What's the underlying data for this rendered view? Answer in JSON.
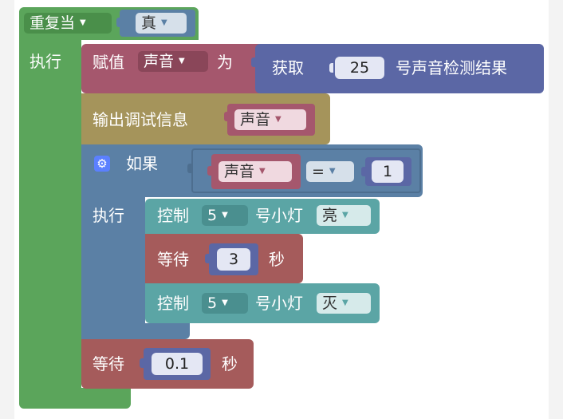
{
  "colors": {
    "loop_green": "#5ba55b",
    "assign_maroon": "#a5576d",
    "get_indigo": "#5b67a5",
    "debug_olive": "#a5945b",
    "if_blue": "#5b80a5",
    "control_teal": "#5ba5a5",
    "wait_red": "#a55b5b",
    "value_teal_dark": "#4a8f8f"
  },
  "loop": {
    "keyword": "重复当",
    "condition": "真",
    "do_label": "执行"
  },
  "assign": {
    "keyword": "赋值",
    "variable": "声音",
    "as_label": "为"
  },
  "get_sensor": {
    "keyword": "获取",
    "port": "25",
    "suffix": "号声音检测结果"
  },
  "debug": {
    "keyword": "输出调试信息",
    "variable": "声音"
  },
  "if_block": {
    "keyword": "如果",
    "do_label": "执行",
    "left": "声音",
    "operator": "=",
    "right": "1"
  },
  "control_on": {
    "keyword": "控制",
    "port": "5",
    "target": "号小灯",
    "state": "亮"
  },
  "wait_inner": {
    "keyword": "等待",
    "value": "3",
    "unit": "秒"
  },
  "control_off": {
    "keyword": "控制",
    "port": "5",
    "target": "号小灯",
    "state": "灭"
  },
  "wait_outer": {
    "keyword": "等待",
    "value": "0.1",
    "unit": "秒"
  }
}
